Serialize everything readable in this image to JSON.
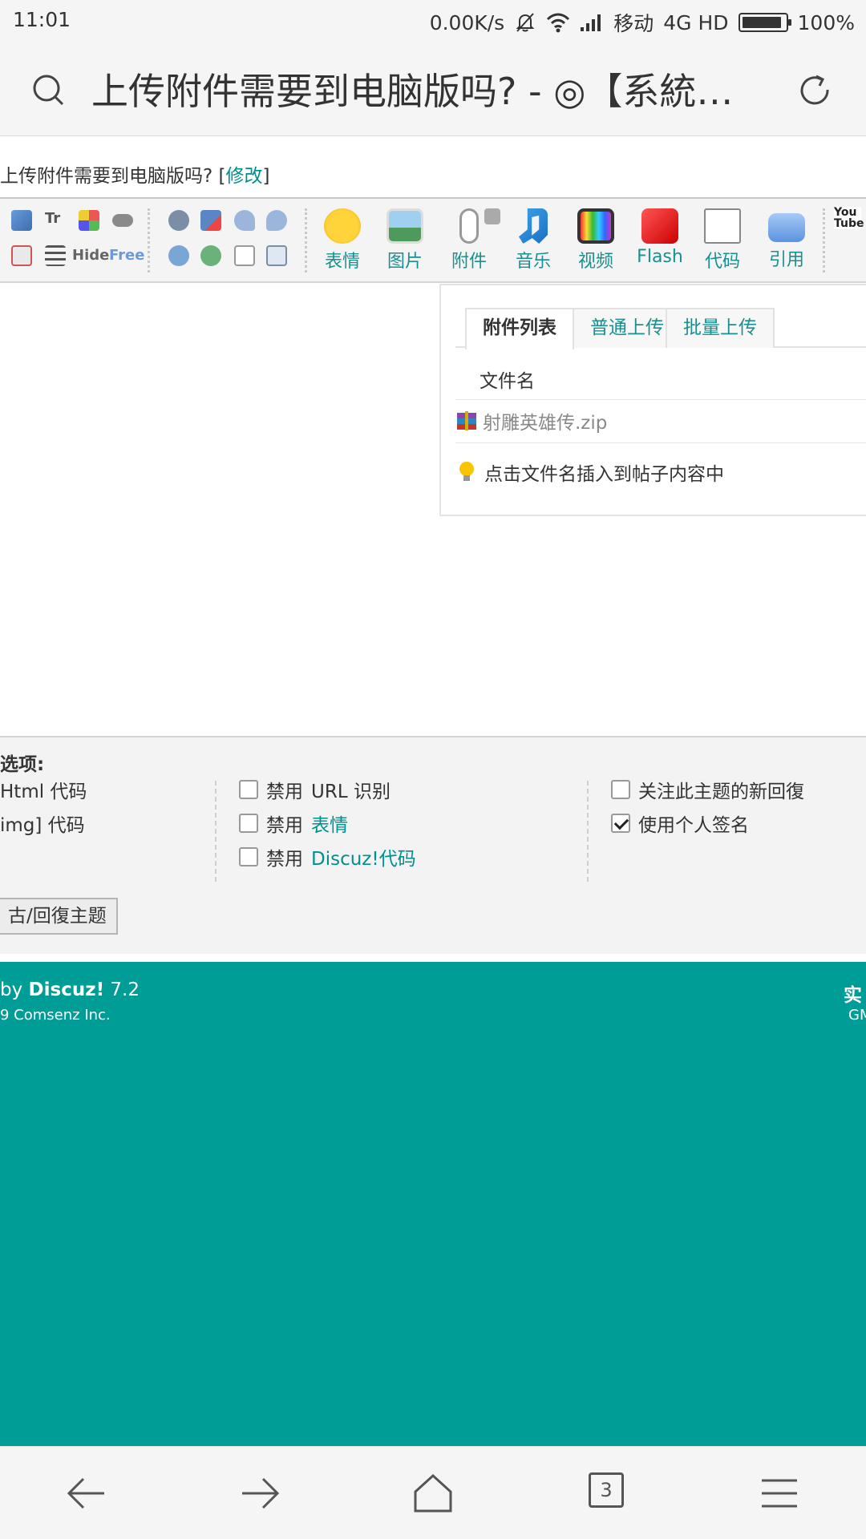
{
  "status_bar": {
    "time": "11:01",
    "net_speed": "0.00K/s",
    "carrier": "移动",
    "network": "4G HD",
    "battery": "100%",
    "icons": [
      "mute-bell-icon",
      "wifi-icon",
      "signal-icon",
      "battery-icon"
    ]
  },
  "browser": {
    "page_title": "上传附件需要到电脑版吗? - ◎【系統…",
    "tab_count": "3"
  },
  "breadcrumb": {
    "text": "上传附件需要到电脑版吗? [",
    "edit_link": "修改",
    "close": "]"
  },
  "toolbar": {
    "small_tools": [
      "Tr",
      "Hide",
      "Free"
    ],
    "big_buttons": [
      {
        "label": "表情",
        "icon": "smiley-icon"
      },
      {
        "label": "图片",
        "icon": "image-icon"
      },
      {
        "label": "附件",
        "icon": "paperclip-icon"
      },
      {
        "label": "音乐",
        "icon": "music-icon"
      },
      {
        "label": "视频",
        "icon": "video-icon"
      },
      {
        "label": "Flash",
        "icon": "flash-icon"
      },
      {
        "label": "代码",
        "icon": "code-icon"
      },
      {
        "label": "引用",
        "icon": "quote-icon"
      }
    ],
    "youtube_label": "You Tube"
  },
  "attachment_popup": {
    "tabs": [
      "附件列表",
      "普通上传",
      "批量上传"
    ],
    "column_header": "文件名",
    "files": [
      "射雕英雄传.zip"
    ],
    "tip": "点击文件名插入到帖子内容中"
  },
  "options": {
    "label": "选项:",
    "col1": [
      "Html 代码",
      "img] 代码"
    ],
    "col2": [
      {
        "prefix": "禁用",
        "text": "URL 识别",
        "link": false,
        "checked": false
      },
      {
        "prefix": "禁用",
        "text": "表情",
        "link": true,
        "checked": false
      },
      {
        "prefix": "禁用",
        "text": "Discuz!代码",
        "link": true,
        "checked": false
      }
    ],
    "col3": [
      {
        "text": "关注此主题的新回復",
        "checked": false
      },
      {
        "text": "使用个人签名",
        "checked": true
      }
    ],
    "submit": "古/回復主题"
  },
  "footer": {
    "powered_prefix": "by ",
    "powered_brand": "Discuz!",
    "powered_version": " 7.2",
    "copyright": "9 Comsenz Inc.",
    "right_top": "实",
    "right_bottom": "GM"
  },
  "colors": {
    "accent": "#008f8f",
    "footer_bg": "#009c96"
  }
}
